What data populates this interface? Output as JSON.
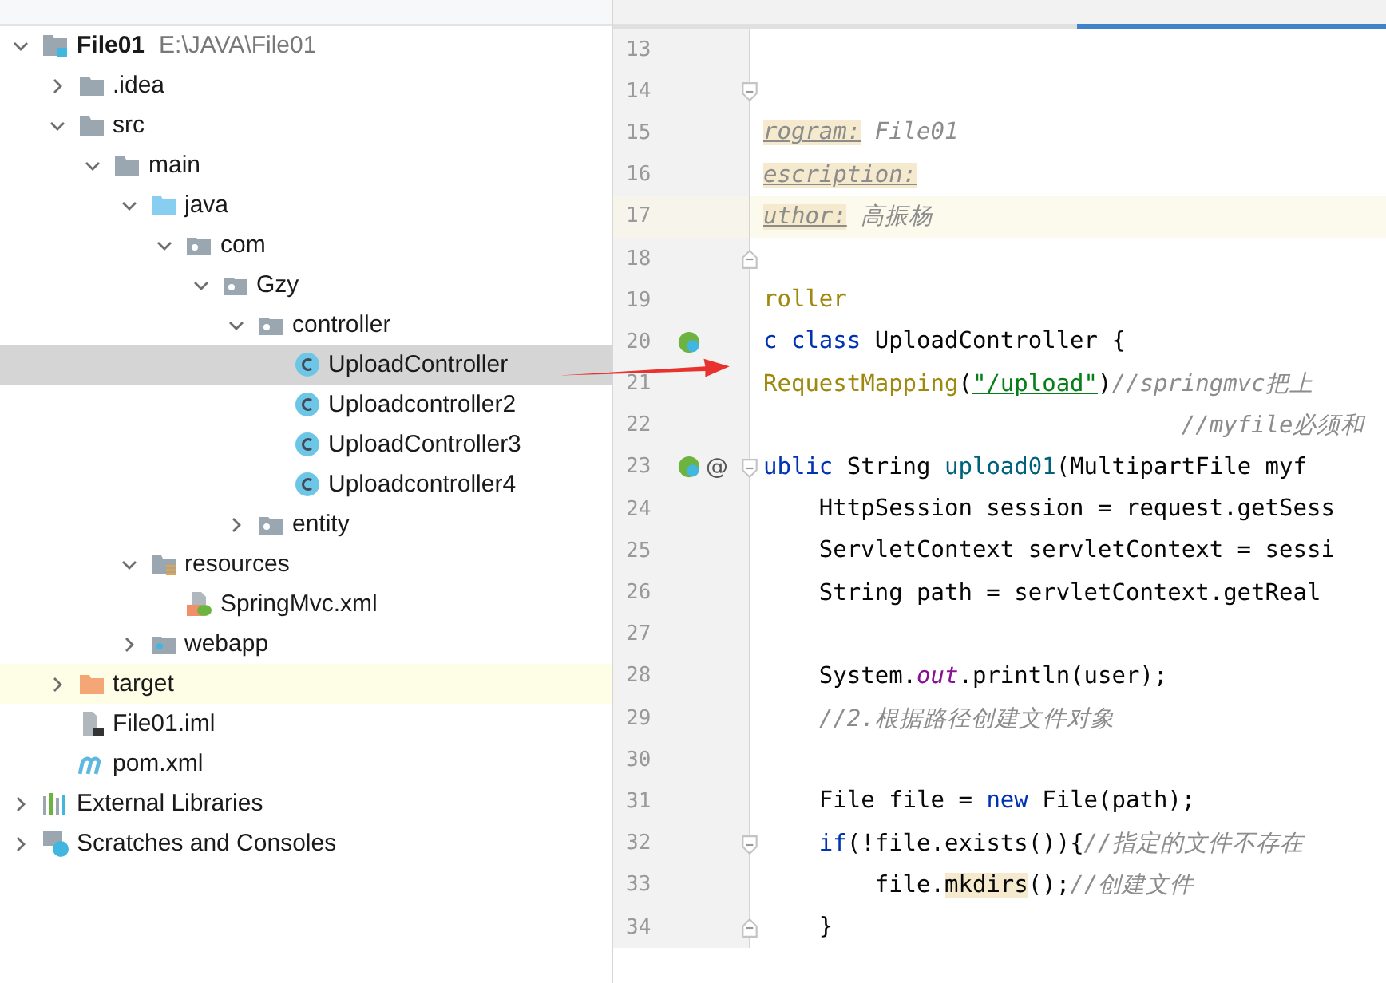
{
  "project_tree": [
    {
      "name": "File01",
      "path": "E:\\JAVA\\File01",
      "kind": "module",
      "expanded": true,
      "selected": false,
      "highlighted": false,
      "children": [
        {
          "name": ".idea",
          "kind": "folder",
          "expanded": false,
          "selected": false,
          "highlighted": false
        },
        {
          "name": "src",
          "kind": "folder",
          "expanded": true,
          "selected": false,
          "highlighted": false,
          "children": [
            {
              "name": "main",
              "kind": "folder",
              "expanded": true,
              "selected": false,
              "highlighted": false,
              "children": [
                {
                  "name": "java",
                  "kind": "sources",
                  "expanded": true,
                  "selected": false,
                  "highlighted": false,
                  "children": [
                    {
                      "name": "com",
                      "kind": "package",
                      "expanded": true,
                      "selected": false,
                      "highlighted": false,
                      "children": [
                        {
                          "name": "Gzy",
                          "kind": "package",
                          "expanded": true,
                          "selected": false,
                          "highlighted": false,
                          "children": [
                            {
                              "name": "controller",
                              "kind": "package",
                              "expanded": true,
                              "selected": false,
                              "highlighted": false,
                              "children": [
                                {
                                  "name": "UploadController",
                                  "kind": "class",
                                  "selected": true,
                                  "highlighted": false
                                },
                                {
                                  "name": "Uploadcontroller2",
                                  "kind": "class",
                                  "selected": false,
                                  "highlighted": false
                                },
                                {
                                  "name": "UploadController3",
                                  "kind": "class",
                                  "selected": false,
                                  "highlighted": false
                                },
                                {
                                  "name": "Uploadcontroller4",
                                  "kind": "class",
                                  "selected": false,
                                  "highlighted": false
                                }
                              ]
                            },
                            {
                              "name": "entity",
                              "kind": "package",
                              "expanded": false,
                              "selected": false,
                              "highlighted": false
                            }
                          ]
                        }
                      ]
                    }
                  ]
                },
                {
                  "name": "resources",
                  "kind": "resources",
                  "expanded": true,
                  "selected": false,
                  "highlighted": false,
                  "children": [
                    {
                      "name": "SpringMvc.xml",
                      "kind": "spring",
                      "selected": false,
                      "highlighted": false
                    }
                  ]
                },
                {
                  "name": "webapp",
                  "kind": "web",
                  "expanded": false,
                  "selected": false,
                  "highlighted": false
                }
              ]
            }
          ]
        },
        {
          "name": "target",
          "kind": "excluded",
          "expanded": false,
          "selected": false,
          "highlighted": true
        },
        {
          "name": "File01.iml",
          "kind": "iml",
          "selected": false,
          "highlighted": false
        },
        {
          "name": "pom.xml",
          "kind": "maven",
          "selected": false,
          "highlighted": false
        }
      ]
    },
    {
      "name": "External Libraries",
      "kind": "libraries",
      "expanded": false,
      "selected": false,
      "highlighted": false
    },
    {
      "name": "Scratches and Consoles",
      "kind": "scratches",
      "expanded": false,
      "selected": false,
      "highlighted": false
    }
  ],
  "editor": {
    "lines": [
      {
        "number": "13",
        "kind": "plain",
        "current": false
      },
      {
        "number": "14",
        "kind": "fold-start",
        "current": false
      },
      {
        "number": "15",
        "kind": "plain",
        "current": false,
        "tokens": [
          {
            "kind": "doc-tag",
            "text": "rogram:"
          },
          {
            "kind": "doc-value",
            "text": " File01"
          }
        ]
      },
      {
        "number": "16",
        "kind": "plain",
        "current": false,
        "tokens": [
          {
            "kind": "doc-tag",
            "text": "escription:"
          }
        ]
      },
      {
        "number": "17",
        "kind": "plain",
        "current": true,
        "tokens": [
          {
            "kind": "doc-tag",
            "text": "uthor:"
          },
          {
            "kind": "doc-value",
            "text": " 高振杨"
          }
        ]
      },
      {
        "number": "18",
        "kind": "fold-end",
        "current": false
      },
      {
        "number": "19",
        "kind": "plain",
        "current": false,
        "tokens": [
          {
            "kind": "annotation",
            "text": "roller"
          }
        ]
      },
      {
        "number": "20",
        "kind": "bean",
        "current": false,
        "tokens": [
          {
            "kind": "keyword",
            "text": "c class "
          },
          {
            "kind": "plain",
            "text": "UploadController {"
          }
        ]
      },
      {
        "number": "21",
        "kind": "plain",
        "current": false,
        "tokens": [
          {
            "kind": "annotation",
            "text": "RequestMapping"
          },
          {
            "kind": "plain",
            "text": "("
          },
          {
            "kind": "string",
            "text": "\"/upload\""
          },
          {
            "kind": "plain",
            "text": ")"
          },
          {
            "kind": "comment",
            "text": "//springmvc把上"
          }
        ]
      },
      {
        "number": "22",
        "kind": "plain",
        "current": false,
        "tokens": [
          {
            "kind": "comment",
            "text": "                              //myfile必须和"
          }
        ]
      },
      {
        "number": "23",
        "kind": "method",
        "gutter_mark": "@",
        "current": false,
        "tokens": [
          {
            "kind": "keyword",
            "text": "ublic "
          },
          {
            "kind": "plain",
            "text": "String "
          },
          {
            "kind": "method",
            "text": "upload01"
          },
          {
            "kind": "plain",
            "text": "(MultipartFile myf"
          }
        ]
      },
      {
        "number": "24",
        "kind": "plain",
        "current": false,
        "tokens": [
          {
            "kind": "plain",
            "text": "    HttpSession session = request.getSess"
          }
        ]
      },
      {
        "number": "25",
        "kind": "plain",
        "current": false,
        "tokens": [
          {
            "kind": "plain",
            "text": "    ServletContext servletContext = sessi"
          }
        ]
      },
      {
        "number": "26",
        "kind": "plain",
        "current": false,
        "tokens": [
          {
            "kind": "plain",
            "text": "    String path = servletContext.getReal"
          }
        ]
      },
      {
        "number": "27",
        "kind": "plain",
        "current": false
      },
      {
        "number": "28",
        "kind": "plain",
        "current": false,
        "tokens": [
          {
            "kind": "plain",
            "text": "    System."
          },
          {
            "kind": "static",
            "text": "out"
          },
          {
            "kind": "plain",
            "text": ".println(user);"
          }
        ]
      },
      {
        "number": "29",
        "kind": "plain",
        "current": false,
        "tokens": [
          {
            "kind": "comment",
            "text": "    //2.根据路径创建文件对象"
          }
        ]
      },
      {
        "number": "30",
        "kind": "plain",
        "current": false
      },
      {
        "number": "31",
        "kind": "plain",
        "current": false,
        "tokens": [
          {
            "kind": "plain",
            "text": "    File file = "
          },
          {
            "kind": "keyword",
            "text": "new"
          },
          {
            "kind": "plain",
            "text": " File(path);"
          }
        ]
      },
      {
        "number": "32",
        "kind": "fold-start",
        "current": false,
        "tokens": [
          {
            "kind": "keyword",
            "text": "    if"
          },
          {
            "kind": "plain",
            "text": "(!file.exists()){"
          },
          {
            "kind": "comment",
            "text": "//指定的文件不存在"
          }
        ]
      },
      {
        "number": "33",
        "kind": "plain",
        "current": false,
        "tokens": [
          {
            "kind": "plain",
            "text": "        file."
          },
          {
            "kind": "usage",
            "text": "mkdirs"
          },
          {
            "kind": "plain",
            "text": "();"
          },
          {
            "kind": "comment",
            "text": "//创建文件"
          }
        ]
      },
      {
        "number": "34",
        "kind": "fold-end",
        "current": false,
        "tokens": [
          {
            "kind": "plain",
            "text": "    }"
          }
        ]
      }
    ]
  }
}
